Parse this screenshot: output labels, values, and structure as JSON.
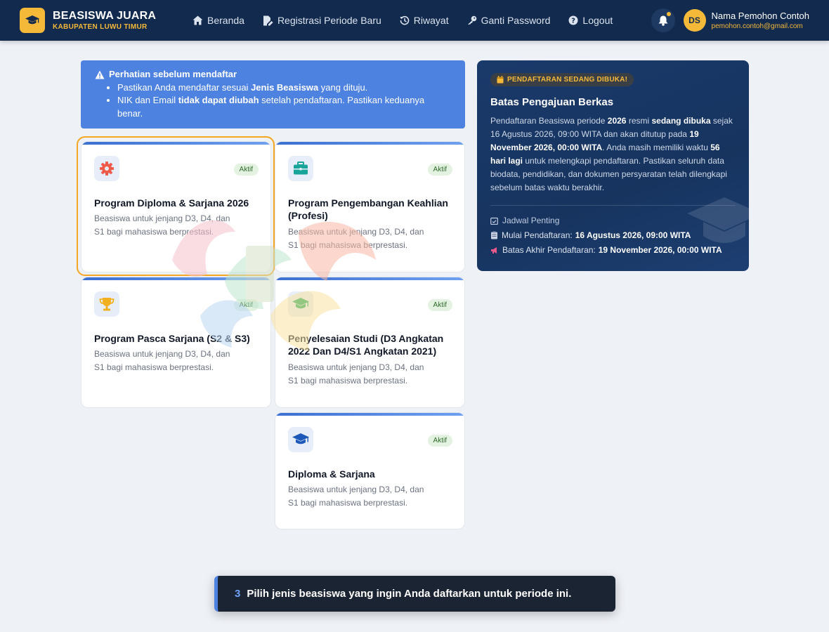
{
  "brand": {
    "title": "BEASISWA JUARA",
    "subtitle": "KABUPATEN LUWU TIMUR",
    "accent": "#f5b93a",
    "logo_icon": "graduation-cap-icon"
  },
  "nav": {
    "items": [
      {
        "label": "Beranda",
        "icon": "home-icon"
      },
      {
        "label": "Registrasi Periode Baru",
        "icon": "file-edit-icon"
      },
      {
        "label": "Riwayat",
        "icon": "history-icon"
      },
      {
        "label": "Ganti Password",
        "icon": "key-icon"
      },
      {
        "label": "Logout",
        "icon": "question-circle-icon"
      }
    ]
  },
  "user": {
    "initials": "DS",
    "name": "Nama Pemohon Contoh",
    "email": "pemohon.contoh@gmail.com"
  },
  "alert": {
    "title": "Perhatian sebelum mendaftar",
    "item1_pre": "Pastikan Anda mendaftar sesuai ",
    "item1_bold": "Jenis Beasiswa",
    "item1_post": " yang dituju.",
    "item2_pre": "NIK dan Email ",
    "item2_bold": "tidak dapat diubah",
    "item2_post": " setelah pendaftaran. Pastikan keduanya benar."
  },
  "cards": [
    {
      "title": "Program Diploma & Sarjana 2026",
      "badge": "Aktif",
      "desc": "Beasiswa untuk jenjang D3, D4, dan S1 bagi mahasiswa berprestasi.",
      "icon": "gear-icon"
    },
    {
      "title": "Program Pengembangan Keahlian (Profesi)",
      "badge": "Aktif",
      "desc": "Beasiswa untuk jenjang D3, D4, dan S1 bagi mahasiswa berprestasi.",
      "icon": "briefcase-icon"
    },
    {
      "title": "Program Pasca Sarjana (S2 & S3)",
      "badge": "Aktif",
      "desc": "Beasiswa untuk jenjang D3, D4, dan S1 bagi mahasiswa berprestasi.",
      "icon": "trophy-icon"
    },
    {
      "title": "Penyelesaian Studi (D3 Angkatan 2022 Dan D4/S1 Angkatan 2021)",
      "badge": "Aktif",
      "desc": "Beasiswa untuk jenjang D3, D4, dan S1 bagi mahasiswa berprestasi.",
      "icon": "graduation-cap-icon"
    },
    {
      "title": "Diploma & Sarjana",
      "badge": "Aktif",
      "desc": "Beasiswa untuk jenjang D3, D4, dan S1 bagi mahasiswa berprestasi.",
      "icon": "graduation-cap-icon"
    }
  ],
  "panel": {
    "badge": "PENDAFTARAN SEDANG DIBUKA!",
    "title": "Batas Pengajuan Berkas",
    "t1": "Pendaftaran Beasiswa periode ",
    "t_year": "2026",
    "t2": " resmi ",
    "t_open": "sedang dibuka",
    "t3": " sejak 16 Agustus 2026, 09:00 WITA dan akan ditutup pada ",
    "t_close": "19 November 2026, 00:00 WITA",
    "t4": ". Anda masih memiliki waktu ",
    "t_days": "56 hari lagi",
    "t5": " untuk melengkapi pendaftaran. Pastikan seluruh data biodata, pendidikan, dan dokumen persyaratan telah dilengkapi sebelum batas waktu berakhir.",
    "schedule_title": "Jadwal Penting",
    "start_label": "Mulai Pendaftaran:",
    "start_value": "16 Agustus 2026, 09:00 WITA",
    "end_label": "Batas Akhir Pendaftaran:",
    "end_value": "19 November 2026, 00:00 WITA"
  },
  "toast": {
    "step": "3",
    "text": "Pilih jenis beasiswa yang ingin Anda daftarkan untuk periode ini."
  }
}
